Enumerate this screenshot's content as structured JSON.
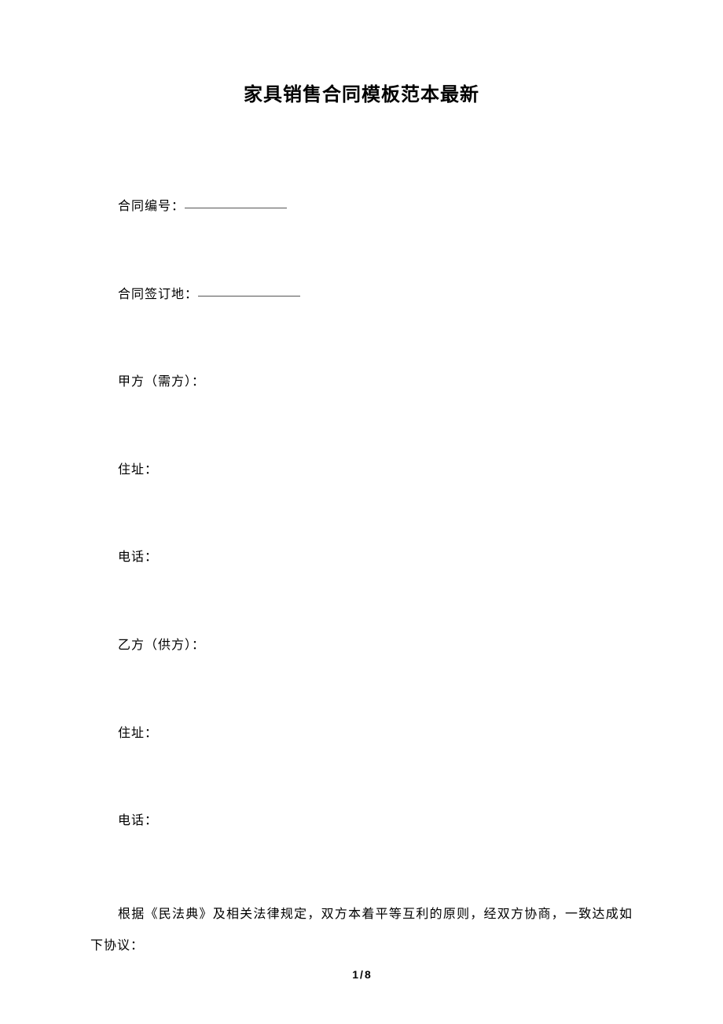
{
  "title": "家具销售合同模板范本最新",
  "fields": {
    "contract_number_label": "合同编号：",
    "contract_location_label": "合同签订地：",
    "party_a_label": "甲方（需方）：",
    "address_a_label": "住址：",
    "phone_a_label": "电话：",
    "party_b_label": "乙方（供方）：",
    "address_b_label": "住址：",
    "phone_b_label": "电话："
  },
  "body_paragraph": "根据《民法典》及相关法律规定，双方本着平等互利的原则，经双方协商，一致达成如下协议：",
  "page": {
    "current": "1",
    "separator": "/",
    "total": "8"
  }
}
